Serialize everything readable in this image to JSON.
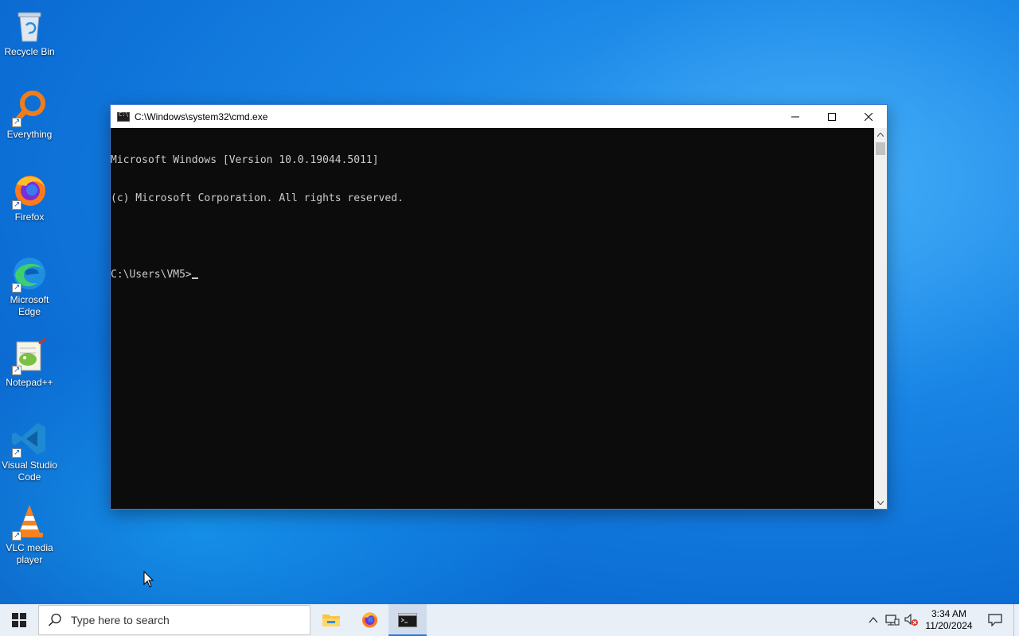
{
  "desktop": {
    "icons": [
      {
        "label": "Recycle Bin",
        "icon": "recycle-bin-icon"
      },
      {
        "label": "Everything",
        "icon": "everything-search-icon"
      },
      {
        "label": "Firefox",
        "icon": "firefox-icon"
      },
      {
        "label": "Microsoft Edge",
        "icon": "edge-icon"
      },
      {
        "label": "Notepad++",
        "icon": "notepadpp-icon"
      },
      {
        "label": "Visual Studio Code",
        "icon": "vscode-icon"
      },
      {
        "label": "VLC media player",
        "icon": "vlc-icon"
      }
    ]
  },
  "cmd": {
    "title": "C:\\Windows\\system32\\cmd.exe",
    "lines": [
      "Microsoft Windows [Version 10.0.19044.5011]",
      "(c) Microsoft Corporation. All rights reserved.",
      "",
      "C:\\Users\\VM5>"
    ]
  },
  "taskbar": {
    "search_placeholder": "Type here to search",
    "apps": [
      {
        "name": "File Explorer",
        "icon": "file-explorer-icon",
        "active": false
      },
      {
        "name": "Firefox",
        "icon": "firefox-icon",
        "active": false
      },
      {
        "name": "Command Prompt",
        "icon": "cmd-icon",
        "active": true
      }
    ],
    "clock": {
      "time": "3:34 AM",
      "date": "11/20/2024"
    }
  },
  "colors": {
    "accent": "#2b79d7",
    "console_bg": "#0c0c0c",
    "console_fg": "#cccccc",
    "taskbar_bg": "#e8eff7"
  }
}
